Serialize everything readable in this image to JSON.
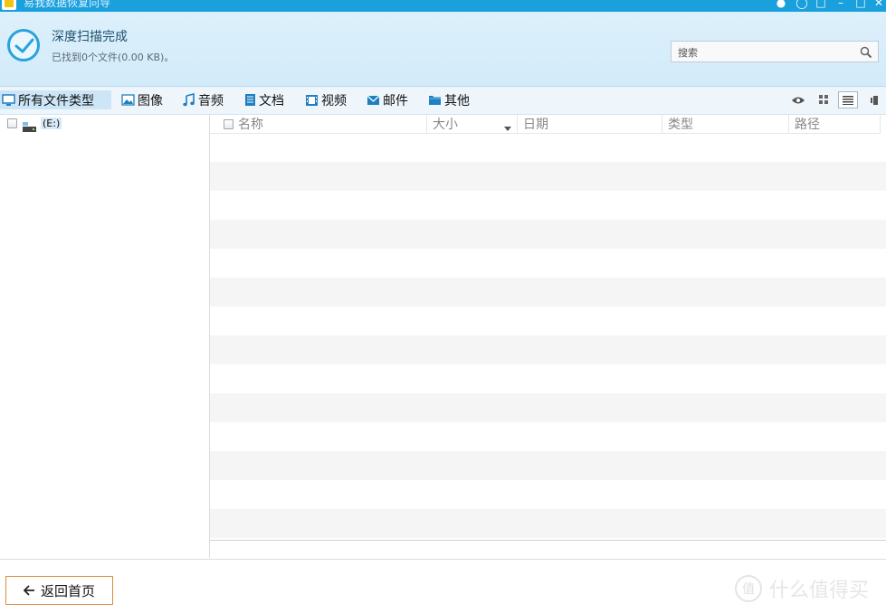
{
  "window": {
    "title": "易我数据恢复向导",
    "controls": [
      "chat-icon",
      "status-icon",
      "help-icon",
      "minimize-icon",
      "maximize-icon",
      "close-icon"
    ]
  },
  "header": {
    "status_title": "深度扫描完成",
    "status_sub": "已找到0个文件(0.00 KB)。",
    "search_placeholder": "搜索"
  },
  "categories": [
    {
      "label": "所有文件类型",
      "icon": "monitor-icon",
      "active": true
    },
    {
      "label": "图像",
      "icon": "image-icon"
    },
    {
      "label": "音频",
      "icon": "music-note-icon"
    },
    {
      "label": "文档",
      "icon": "document-icon"
    },
    {
      "label": "视频",
      "icon": "film-icon"
    },
    {
      "label": "邮件",
      "icon": "envelope-icon"
    },
    {
      "label": "其他",
      "icon": "folder-icon"
    }
  ],
  "view_modes": [
    "preview-eye-icon",
    "thumbnail-grid-icon",
    "list-view-icon",
    "details-pane-icon"
  ],
  "tree": {
    "drive_label": "(E:)"
  },
  "file_list": {
    "columns": [
      "名称",
      "大小",
      "日期",
      "类型",
      "路径"
    ],
    "sorted_column": "大小",
    "rows": []
  },
  "footer": {
    "back_label": "返回首页",
    "watermark": "什么值得买"
  },
  "colors": {
    "titlebar": "#1aa0dd",
    "header_bg": "#d8eefb",
    "accent": "#29a3db",
    "back_button_border": "#e08b3c"
  }
}
